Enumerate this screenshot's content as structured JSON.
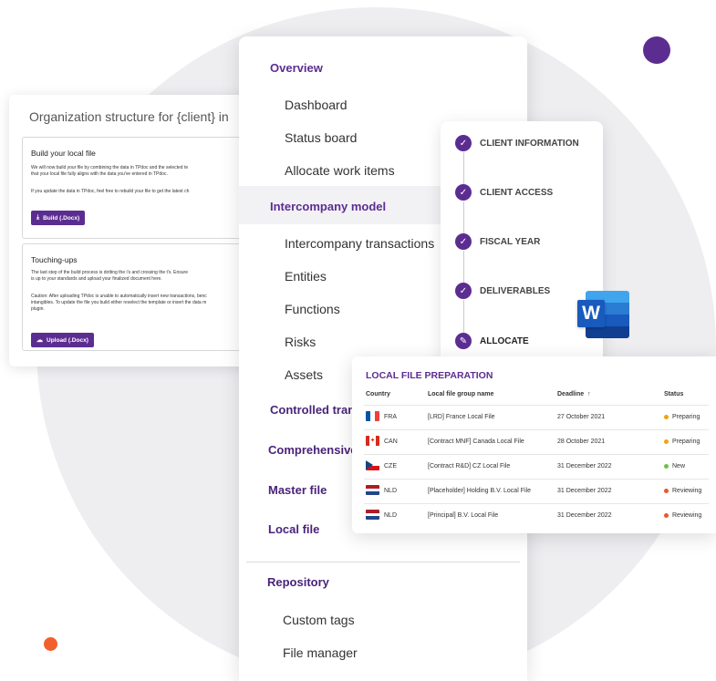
{
  "colors": {
    "brand": "#5c2d91",
    "accent": "#f1602c",
    "preparing": "#f0a30a",
    "new": "#6cc24a",
    "reviewing": "#e8572a"
  },
  "org_card": {
    "title": "Organization structure for {client} in",
    "build": {
      "heading": "Build your local file",
      "line1": "We will now build your file by combining the data in TPdoc and the selected te",
      "line2": "that your local file fully aligns with the data you've entered in TPdoc.",
      "line3": "If you update the data in TPdoc, feel free to rebuild your file to get the latest ch",
      "button": "Build (.Docx)"
    },
    "touch": {
      "heading": "Touching-ups",
      "line1": "The last step of the build process is dotting the i's and crossing the t's. Ensure",
      "line2": "is up to your standards and upload your finalized document here.",
      "line3": "Caution: After uploading TPdoc is unable to automatically insert new transactions, benc",
      "line4": "intangibles. To update the file you build either reselect the template or insert the data m",
      "line5": "plugin.",
      "button": "Upload (.Docx)"
    }
  },
  "nav": {
    "overview": "Overview",
    "dashboard": "Dashboard",
    "status_board": "Status board",
    "allocate": "Allocate work items",
    "intercompany_model": "Intercompany model",
    "ic_transactions": "Intercompany transactions",
    "entities": "Entities",
    "functions": "Functions",
    "risks": "Risks",
    "assets": "Assets",
    "controlled": "Controlled transactions",
    "comprehensive": "Comprehensive",
    "master_file": "Master file",
    "local_file": "Local file",
    "repository": "Repository",
    "custom_tags": "Custom tags",
    "file_manager": "File manager"
  },
  "stepper": {
    "steps": [
      {
        "label": "CLIENT INFORMATION",
        "icon": "check-icon"
      },
      {
        "label": "CLIENT ACCESS",
        "icon": "check-icon"
      },
      {
        "label": "FISCAL YEAR",
        "icon": "check-icon"
      },
      {
        "label": "DELIVERABLES",
        "icon": "check-icon"
      },
      {
        "label": "ALLOCATE",
        "icon": "pencil-icon"
      }
    ]
  },
  "word_icon": {
    "letter": "W"
  },
  "local_file_table": {
    "title": "LOCAL FILE PREPARATION",
    "headers": {
      "country": "Country",
      "group": "Local file group name",
      "deadline": "Deadline",
      "status": "Status"
    },
    "rows": [
      {
        "code": "FRA",
        "name": "[LRD] France Local File",
        "deadline": "27 October 2021",
        "status": "Preparing",
        "flag": "fr"
      },
      {
        "code": "CAN",
        "name": "[Contract MNF] Canada Local File",
        "deadline": "28 October 2021",
        "status": "Preparing",
        "flag": "ca"
      },
      {
        "code": "CZE",
        "name": "[Contract R&D] CZ Local File",
        "deadline": "31 December 2022",
        "status": "New",
        "flag": "cz"
      },
      {
        "code": "NLD",
        "name": "[Placeholder] Holding B.V. Local File",
        "deadline": "31 December 2022",
        "status": "Reviewing",
        "flag": "nl"
      },
      {
        "code": "NLD",
        "name": "[Principal] B.V. Local File",
        "deadline": "31 December 2022",
        "status": "Reviewing",
        "flag": "nl"
      }
    ]
  }
}
